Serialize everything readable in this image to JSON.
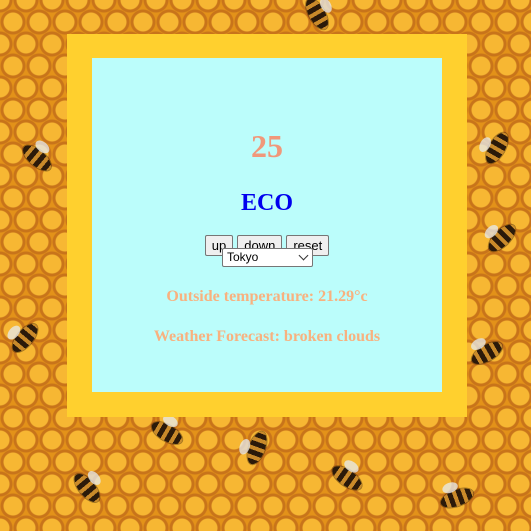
{
  "thermostat": {
    "temperature": "25",
    "mode": "ECO"
  },
  "controls": {
    "up_label": "up",
    "down_label": "down",
    "reset_label": "reset"
  },
  "city_select": {
    "selected": "Tokyo"
  },
  "weather": {
    "outside_temperature": "Outside temperature: 21.29°c",
    "forecast": "Weather Forecast: broken clouds"
  },
  "colors": {
    "frame": "#ffd02e",
    "panel": "#bbfdfb",
    "temperature": "#f0987a",
    "mode": "#0000ee",
    "info_text": "#f8b17f"
  },
  "icons": {
    "select_arrow": "chevron-down-icon"
  }
}
